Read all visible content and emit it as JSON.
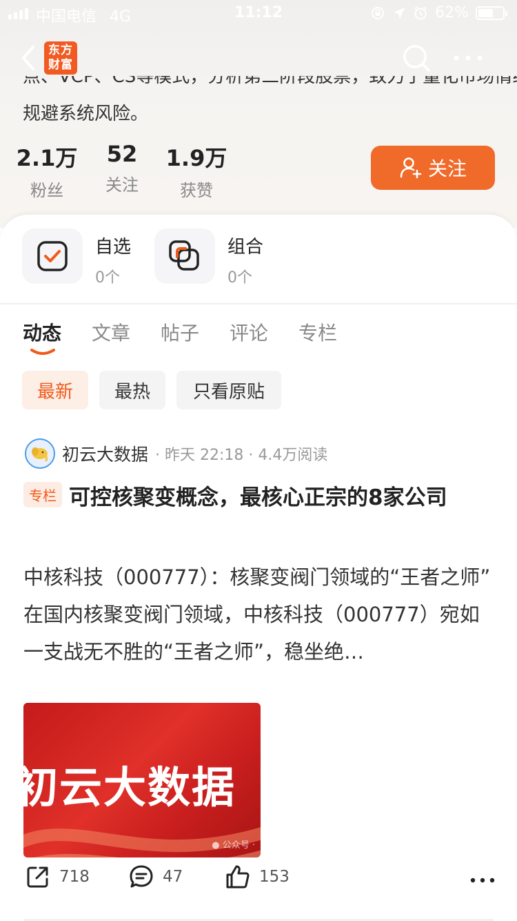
{
  "status_bar": {
    "carrier": "中国电信",
    "network": "4G",
    "time": "11:12",
    "battery": "62%",
    "battery_level": 0.62
  },
  "nav": {
    "logo_line1": "东方",
    "logo_line2": "财富",
    "back_icon": "chevron-left-icon",
    "search_icon": "search-icon",
    "more_icon": "more-horizontal-icon"
  },
  "profile": {
    "bio_cut_line": "点、VCP、CS等模式，分析第三阶段股票，致力于量化市场情绪",
    "bio_last_line": "规避系统风险。",
    "stats": [
      {
        "value": "2.1万",
        "label": "粉丝"
      },
      {
        "value": "52",
        "label": "关注"
      },
      {
        "value": "1.9万",
        "label": "获赞"
      }
    ],
    "follow_label": "关注"
  },
  "shortcuts": [
    {
      "title": "自选",
      "count": "0个",
      "icon": "checkbox-icon"
    },
    {
      "title": "组合",
      "count": "0个",
      "icon": "portfolio-icon"
    }
  ],
  "tabs": [
    "动态",
    "文章",
    "帖子",
    "评论",
    "专栏"
  ],
  "active_tab": "动态",
  "filters": [
    "最新",
    "最热",
    "只看原贴"
  ],
  "active_filter": "最新",
  "post": {
    "author": "初云大数据",
    "meta": "· 昨天 22:18 · 4.4万阅读",
    "tag": "专栏",
    "title": "可控核聚变概念，最核心正宗的8家公司",
    "body_line1": "中核科技（000777）：核聚变阀门领域的“王者之师”",
    "body_line2": "在国内核聚变阀门领域，中核科技（000777）宛如一支战无不胜的“王者之师”，稳坐绝…",
    "image_text": "初云大数据",
    "image_watermark": "公众号 ·",
    "actions": {
      "share": "718",
      "comment": "47",
      "like": "153"
    }
  },
  "colors": {
    "accent": "#f06a2a",
    "logo": "#f15a22",
    "tag_bg": "#fdece3",
    "tag_text": "#f05a1a"
  }
}
